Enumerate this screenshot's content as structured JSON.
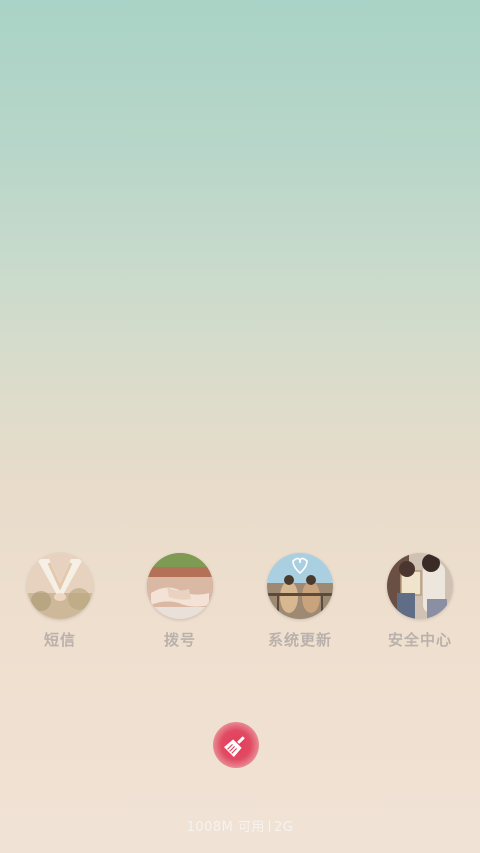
{
  "apps": [
    {
      "label": "短信",
      "icon": "heart-hands-photo-icon"
    },
    {
      "label": "拨号",
      "icon": "holding-hands-photo-icon"
    },
    {
      "label": "系统更新",
      "icon": "couple-on-railing-photo-icon"
    },
    {
      "label": "安全中心",
      "icon": "couple-book-photo-icon"
    }
  ],
  "clean_button": {
    "icon": "broom-icon",
    "color": "#e33b58"
  },
  "memory_status": {
    "free": "1008M 可用",
    "total": "2G"
  }
}
